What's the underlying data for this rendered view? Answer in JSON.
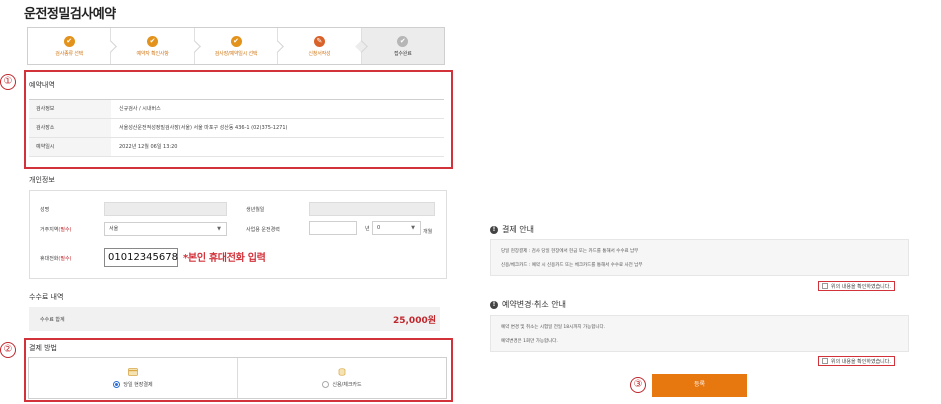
{
  "page": {
    "title": "운전정밀검사예약"
  },
  "stepper": {
    "steps": [
      {
        "label": "검사종류 선택",
        "status": "done"
      },
      {
        "label": "예약자 확인사항",
        "status": "done"
      },
      {
        "label": "검사장/예약일시 선택",
        "status": "done"
      },
      {
        "label": "신청서작성",
        "status": "current"
      },
      {
        "label": "접수완료",
        "status": "pending"
      }
    ],
    "accent": "#e3921c"
  },
  "markers": {
    "one": "①",
    "two": "②",
    "three": "③"
  },
  "reservation": {
    "title": "예약내역",
    "rows": [
      {
        "label": "검사정보",
        "value": "신규검사 / 시내버스"
      },
      {
        "label": "검사장소",
        "value": "서울성산운전적성정밀검사장(서울) 서울 마포구 성산동 436-1 (02)375-1271)"
      },
      {
        "label": "예약일시",
        "value": "2022년 12월 06일 13:20"
      }
    ]
  },
  "personal": {
    "title": "개인정보",
    "name_label": "성명",
    "birth_label": "생년월일",
    "region_label": "거주지역",
    "required_mark": "(필수)",
    "region_value": "서울",
    "career_label": "사업용 운전경력",
    "year_unit": "년",
    "month_value": "0",
    "month_unit": "개월",
    "phone_label": "휴대전화",
    "phone_value": "01012345678",
    "phone_note": "*본인 휴대전화 입력"
  },
  "fee": {
    "title": "수수료 내역",
    "label": "수수료 합계",
    "amount": "25,000원"
  },
  "payment": {
    "title": "결제 방법",
    "options": [
      {
        "label": "당일 현장결제",
        "selected": true
      },
      {
        "label": "신용/체크카드",
        "selected": false
      }
    ]
  },
  "payment_info": {
    "title": "결제 안내",
    "lines": [
      "당일 현장결제 : 검사 당일 현장에서 현금 또는 카드를 통해서 수수료 납부",
      "신용/체크카드 : 예약 시 신용카드 또는 체크카드를 통해서 수수료 사전 납부"
    ],
    "confirm": "위의 내용을 확인하였습니다."
  },
  "change_info": {
    "title": "예약변경·취소 안내",
    "lines": [
      "예약 변경 및 취소는 시험일 전일 18시까지 가능합니다.",
      "예약변경은 1회만 가능합니다."
    ],
    "confirm": "위의 내용을 확인하였습니다."
  },
  "submit": {
    "label": "등록",
    "color": "#e7770f"
  }
}
